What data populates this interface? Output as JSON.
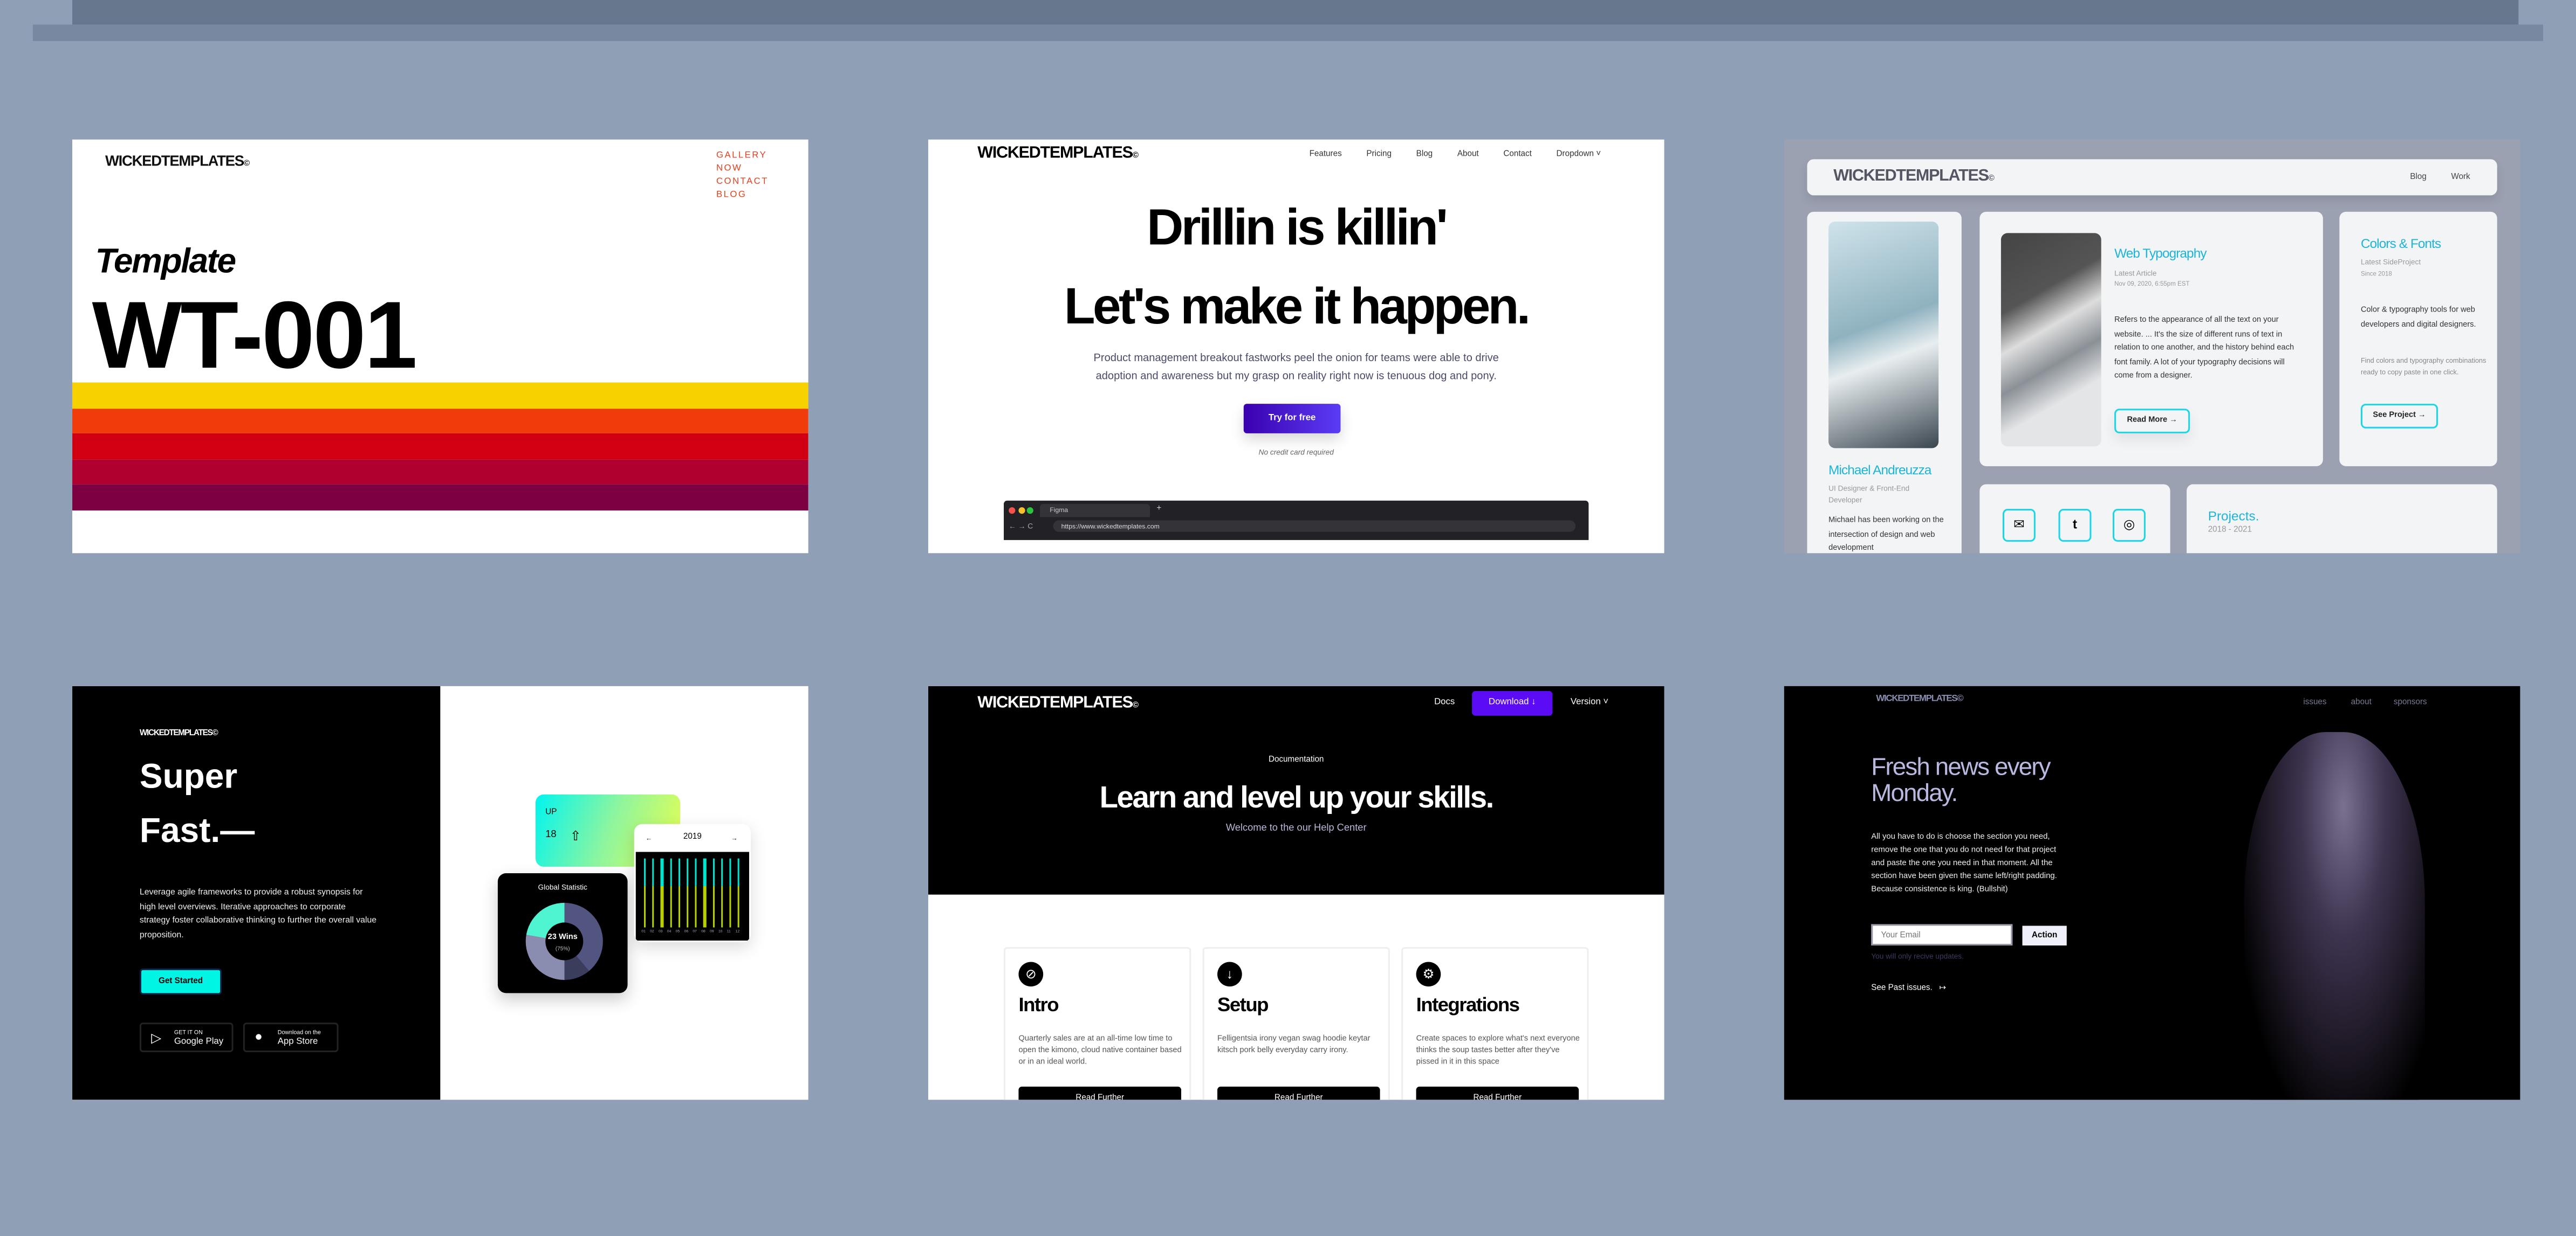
{
  "brand": "WICKEDTEMPLATES",
  "brand_mark": "©",
  "colors": {
    "background": "#8f9fb5",
    "accent_orange": "#e8401c",
    "cyan": "#1cb5d8",
    "purple": "#5b0cf5",
    "aqua": "#00f5e4"
  },
  "card1": {
    "nav": [
      "GALLERY",
      "NOW",
      "CONTACT",
      "BLOG"
    ],
    "kicker": "Template",
    "title": "WT-001"
  },
  "card2": {
    "nav": [
      "Features",
      "Pricing",
      "Blog",
      "About",
      "Contact",
      "Dropdown"
    ],
    "headline1": "Drillin is killin'",
    "headline2": "Let's make it happen.",
    "body": "Product management breakout fastworks peel the onion for teams were able to drive adoption and awareness but my grasp on reality right now is tenuous dog and pony.",
    "cta": "Try for free",
    "note": "No credit card required",
    "browser_tab": "Figma",
    "browser_url": "https://www.wickedtemplates.com"
  },
  "card3": {
    "nav": [
      "Blog",
      "Work"
    ],
    "profile": {
      "name": "Michael Andreuzza",
      "role": "UI Designer & Front-End Developer",
      "bio": "Michael has been working on the intersection of design and web development"
    },
    "article": {
      "title": "Web Typography",
      "label": "Latest Article",
      "date": "Nov 09, 2020, 6:55pm EST",
      "body": "Refers to the appearance of all the text on your website. ... It's the size of different runs of text in relation to one another, and the history behind each font family. A lot of your typography decisions will come from a designer.",
      "button": "Read More →"
    },
    "side": {
      "title": "Colors & Fonts",
      "label": "Latest SideProject",
      "since": "Since 2018",
      "body": "Color & typography tools for web developers and digital designers.",
      "sub": "Find colors and typography combinations ready to copy paste in one click.",
      "button": "See Project →"
    },
    "projects": {
      "title": "Projects.",
      "years": "2018 - 2021"
    },
    "social_icons": [
      "mail-icon",
      "tumblr-icon",
      "dribbble-icon"
    ]
  },
  "card4": {
    "title1": "Super",
    "title2": "Fast.—",
    "body": "Leverage agile frameworks to provide a robust synopsis for high level overviews. Iterative approaches to corporate strategy foster collaborative thinking to further the overall value proposition.",
    "cta": "Get Started",
    "google": {
      "small": "GET IT ON",
      "big": "Google Play"
    },
    "apple": {
      "small": "Download on the",
      "big": "App Store"
    },
    "widget_up": {
      "label": "UP",
      "value": "18"
    },
    "widget_stat": {
      "title": "Global Statistic",
      "wins": "23 Wins",
      "pct": "(75%)"
    },
    "widget_chart": {
      "year": "2019",
      "months": [
        "01",
        "02",
        "03",
        "04",
        "05",
        "06",
        "07",
        "08",
        "09",
        "10",
        "11",
        "12"
      ]
    }
  },
  "card5": {
    "nav": {
      "docs": "Docs",
      "download": "Download ↓",
      "version": "Version ˅"
    },
    "eyebrow": "Documentation",
    "headline": "Learn and level up your skills.",
    "sub": "Welcome to the our Help Center",
    "features": [
      {
        "title": "Intro",
        "icon": "compass-icon",
        "glyph": "⊘",
        "body": "Quarterly sales are at an all-time low time to open the kimono, cloud native container based or in an ideal world.",
        "button": "Read Further"
      },
      {
        "title": "Setup",
        "icon": "arrow-down-icon",
        "glyph": "↓",
        "body": "Felligentsia irony vegan swag hoodie keytar kitsch pork belly everyday carry irony.",
        "button": "Read Further"
      },
      {
        "title": "Integrations",
        "icon": "gear-icon",
        "glyph": "⚙",
        "body": "Create spaces to explore what's next everyone thinks the soup tastes better after they've pissed in it in this space",
        "button": "Read Further"
      }
    ]
  },
  "card6": {
    "nav": [
      "issues",
      "about",
      "sponsors"
    ],
    "headline": "Fresh news every Monday.",
    "body": "All you have to do is choose the section you need, remove the one that you do not need for that project and paste the one you need in that moment. All the section have been given the same left/right padding. Because consistence is king. (Bullshit)",
    "email_placeholder": "Your Email",
    "action": "Action",
    "note": "You will only recive updates.",
    "link": "See Past issues.",
    "link_arrow": "↦"
  }
}
